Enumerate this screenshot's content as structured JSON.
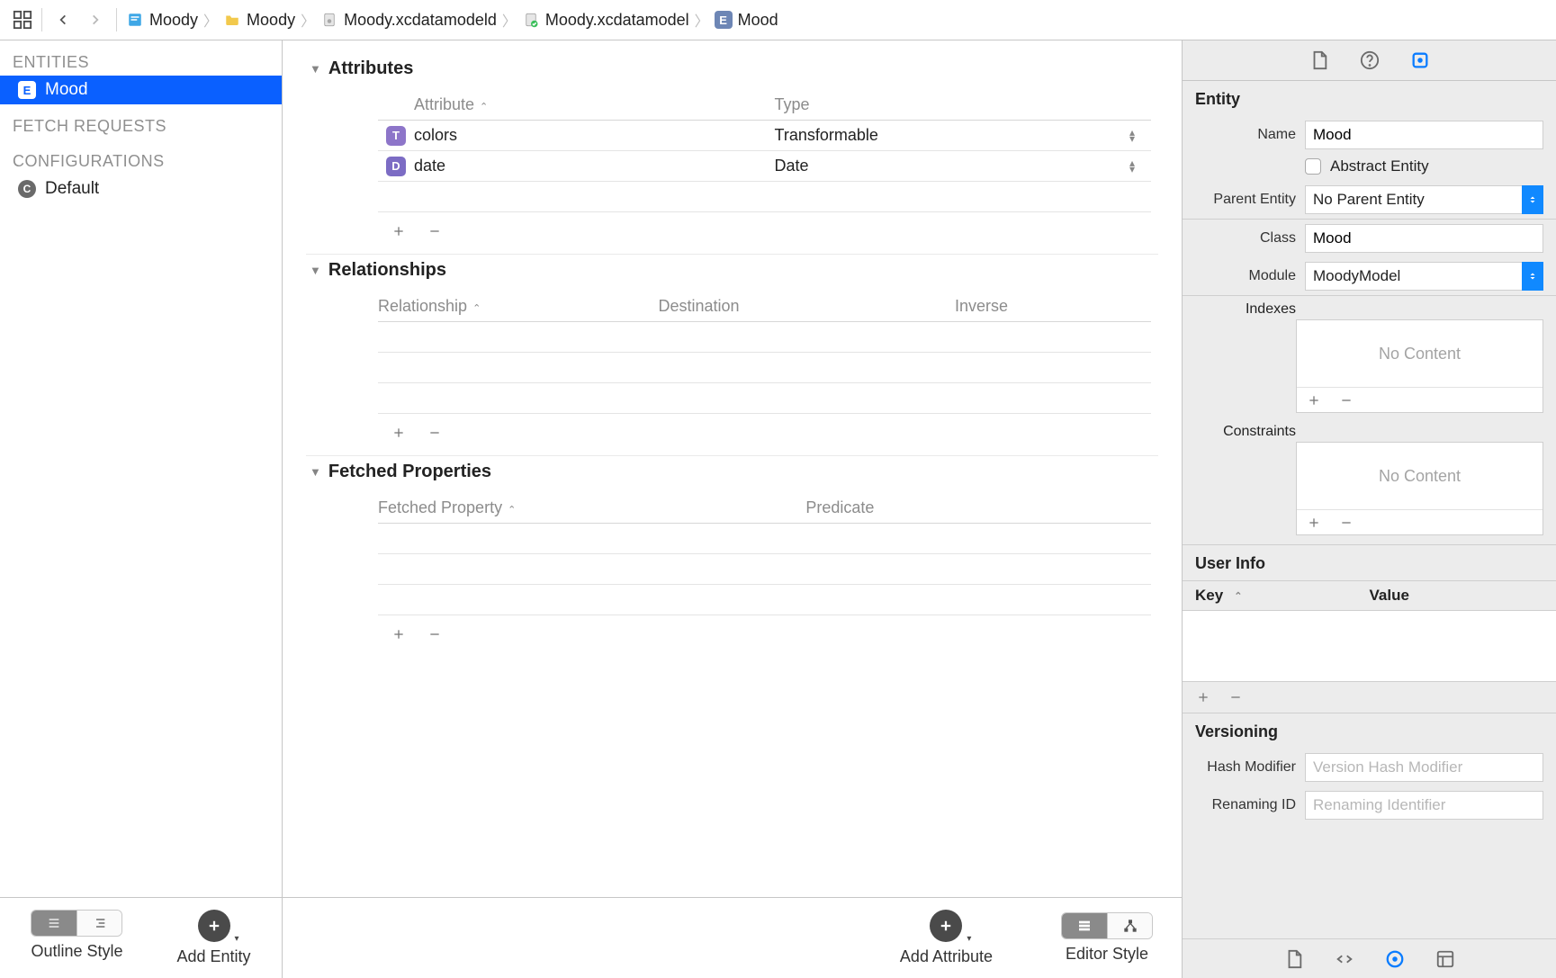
{
  "breadcrumbs": [
    {
      "icon": "project",
      "label": "Moody"
    },
    {
      "icon": "folder",
      "label": "Moody"
    },
    {
      "icon": "datamodel-d",
      "label": "Moody.xcdatamodeld"
    },
    {
      "icon": "datamodel",
      "label": "Moody.xcdatamodel"
    },
    {
      "icon": "entity",
      "label": "Mood"
    }
  ],
  "sidebar": {
    "entities_header": "ENTITIES",
    "fetch_header": "FETCH REQUESTS",
    "config_header": "CONFIGURATIONS",
    "entities": [
      {
        "label": "Mood"
      }
    ],
    "configs": [
      {
        "label": "Default"
      }
    ]
  },
  "center": {
    "sections": {
      "attributes": {
        "title": "Attributes",
        "col_attribute": "Attribute",
        "col_type": "Type",
        "rows": [
          {
            "badge": "T",
            "name": "colors",
            "type": "Transformable"
          },
          {
            "badge": "D",
            "name": "date",
            "type": "Date"
          }
        ]
      },
      "relationships": {
        "title": "Relationships",
        "col_rel": "Relationship",
        "col_dest": "Destination",
        "col_inv": "Inverse"
      },
      "fetched": {
        "title": "Fetched Properties",
        "col_fp": "Fetched Property",
        "col_pred": "Predicate"
      }
    }
  },
  "footer": {
    "outline_style": "Outline Style",
    "add_entity": "Add Entity",
    "add_attribute": "Add Attribute",
    "editor_style": "Editor Style"
  },
  "inspector": {
    "entity_title": "Entity",
    "name_label": "Name",
    "name_value": "Mood",
    "abstract_label": "Abstract Entity",
    "parent_label": "Parent Entity",
    "parent_value": "No Parent Entity",
    "class_label": "Class",
    "class_value": "Mood",
    "module_label": "Module",
    "module_value": "MoodyModel",
    "indexes_label": "Indexes",
    "constraints_label": "Constraints",
    "no_content": "No Content",
    "userinfo_title": "User Info",
    "key_label": "Key",
    "value_label": "Value",
    "versioning_title": "Versioning",
    "hash_label": "Hash Modifier",
    "hash_placeholder": "Version Hash Modifier",
    "renaming_label": "Renaming ID",
    "renaming_placeholder": "Renaming Identifier"
  }
}
